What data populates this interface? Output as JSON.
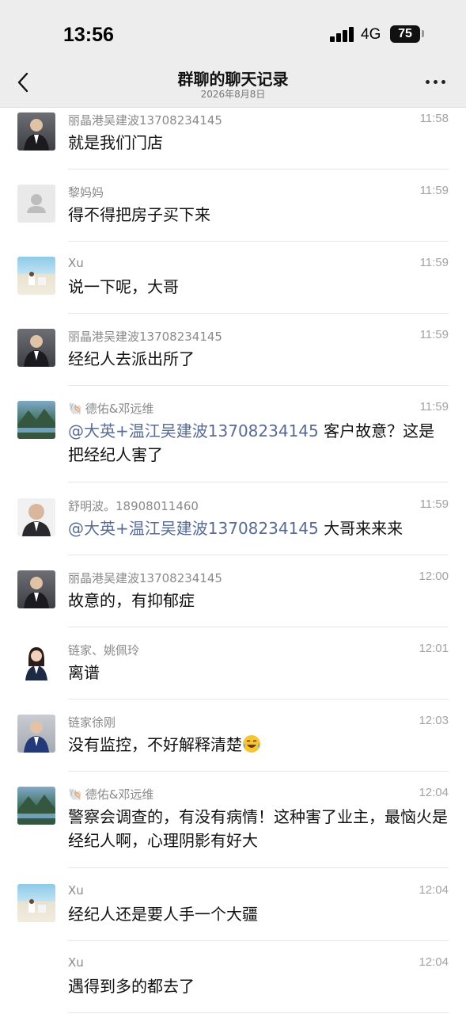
{
  "status": {
    "time": "13:56",
    "network": "4G",
    "battery": "75"
  },
  "nav": {
    "title": "群聊的聊天记录",
    "subtitle": "2026年8月8日"
  },
  "messages": [
    {
      "sender": "丽晶港吴建波13708234145",
      "time": "11:58",
      "avatar": "man-in-suit",
      "text": "就是我们门店"
    },
    {
      "sender": "黎妈妈",
      "time": "11:59",
      "avatar": "default-avatar",
      "text": "得不得把房子买下来"
    },
    {
      "sender": "Xu",
      "time": "11:59",
      "avatar": "beach-photo",
      "text": "说一下呢，大哥"
    },
    {
      "sender": "丽晶港吴建波13708234145",
      "time": "11:59",
      "avatar": "man-in-suit",
      "text": "经纪人去派出所了"
    },
    {
      "sender": "德佑&邓远维",
      "time": "11:59",
      "avatar": "mountain-lake",
      "mention": "@大英+温江吴建波",
      "mention_number": "13708234145",
      "text": " 客户故意？这是把经纪人害了"
    },
    {
      "sender": "舒明波。18908011460",
      "time": "11:59",
      "avatar": "bald-man",
      "mention": "@大英+温江吴建波",
      "mention_number": "13708234145",
      "text": " 大哥来来来"
    },
    {
      "sender": "丽晶港吴建波13708234145",
      "time": "12:00",
      "avatar": "man-in-suit",
      "text": "故意的，有抑郁症"
    },
    {
      "sender": "链家、姚佩玲",
      "time": "12:01",
      "avatar": "woman-in-suit",
      "text": "离谱"
    },
    {
      "sender": "链家徐刚",
      "time": "12:03",
      "avatar": "man-blue-suit",
      "text": "没有监控，不好解释清楚"
    },
    {
      "sender": "德佑&邓远维",
      "time": "12:04",
      "avatar": "mountain-lake",
      "text": "警察会调查的，有没有病情！这种害了业主，最恼火是经纪人啊，心理阴影有好大"
    },
    {
      "sender": "Xu",
      "time": "12:04",
      "avatar": "beach-photo",
      "text": "经纪人还是要人手一个大疆"
    },
    {
      "sender": "Xu",
      "time": "12:04",
      "avatar": "",
      "text": "遇得到多的都去了"
    }
  ]
}
